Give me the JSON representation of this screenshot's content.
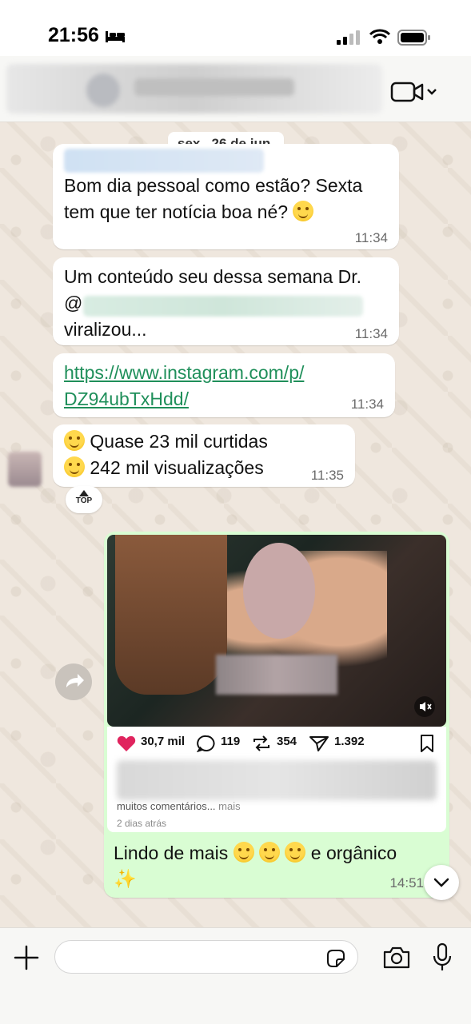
{
  "status_bar": {
    "time": "21:56"
  },
  "chat": {
    "date_label": "sex., 26 de jun."
  },
  "messages": [
    {
      "text_line1": "Bom dia pessoal como estão? Sexta",
      "text_line2": "tem que ter notícia boa né?",
      "time": "11:34"
    },
    {
      "text_line1": "Um conteúdo seu dessa semana Dr.",
      "mention_prefix": "@",
      "text_line3": "viralizou...",
      "time": "11:34"
    },
    {
      "link_line1": "https://www.instagram.com/p/",
      "link_line2": "DZ94ubTxHdd/",
      "time": "11:34"
    },
    {
      "line1": "Quase 23 mil curtidas",
      "line2": "242 mil visualizações",
      "time": "11:35"
    }
  ],
  "top_badge": "TOP",
  "outgoing": {
    "likes": "30,7 mil",
    "comments": "119",
    "reposts": "354",
    "shares": "1.392",
    "comments_text": "muitos comentários...",
    "more_label": "mais",
    "posted_ago": "2 dias atrás",
    "text_part1": "Lindo de mais",
    "text_part2": "e orgânico",
    "time": "14:51"
  },
  "input": {
    "placeholder": ""
  },
  "colors": {
    "wallpaper": "#efe7de",
    "outgoing_bubble": "#d9fdd3",
    "link": "#1f8f5a",
    "like": "#e0245e"
  }
}
